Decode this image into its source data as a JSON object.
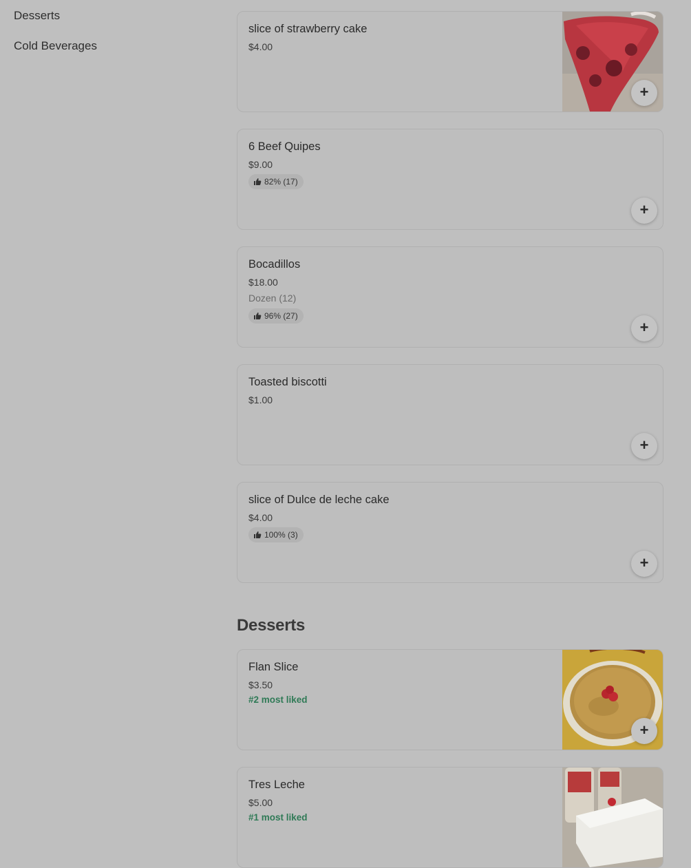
{
  "sidebar": {
    "items": [
      {
        "label": "Desserts"
      },
      {
        "label": "Cold Beverages"
      }
    ]
  },
  "menu": {
    "items": [
      {
        "title": "slice of strawberry cake",
        "price": "$4.00",
        "image": "strawberry-cake-photo"
      },
      {
        "title": "6 Beef Quipes",
        "price": "$9.00",
        "rating": "82% (17)"
      },
      {
        "title": "Bocadillos",
        "price": "$18.00",
        "description": "Dozen (12)",
        "rating": "96% (27)"
      },
      {
        "title": "Toasted biscotti",
        "price": "$1.00"
      },
      {
        "title": "slice of Dulce de leche cake",
        "price": "$4.00",
        "rating": "100% (3)"
      }
    ]
  },
  "desserts": {
    "heading": "Desserts",
    "items": [
      {
        "title": "Flan Slice",
        "price": "$3.50",
        "liked": "#2 most liked",
        "image": "flan-photo"
      },
      {
        "title": "Tres Leche",
        "price": "$5.00",
        "liked": "#1 most liked",
        "image": "tres-leche-photo"
      }
    ]
  },
  "icons": {
    "add": "plus-icon",
    "rating": "thumbs-up-icon"
  },
  "add_label": "+",
  "colors": {
    "background": "#bfbfbf",
    "liked_text": "#2f7a56"
  }
}
